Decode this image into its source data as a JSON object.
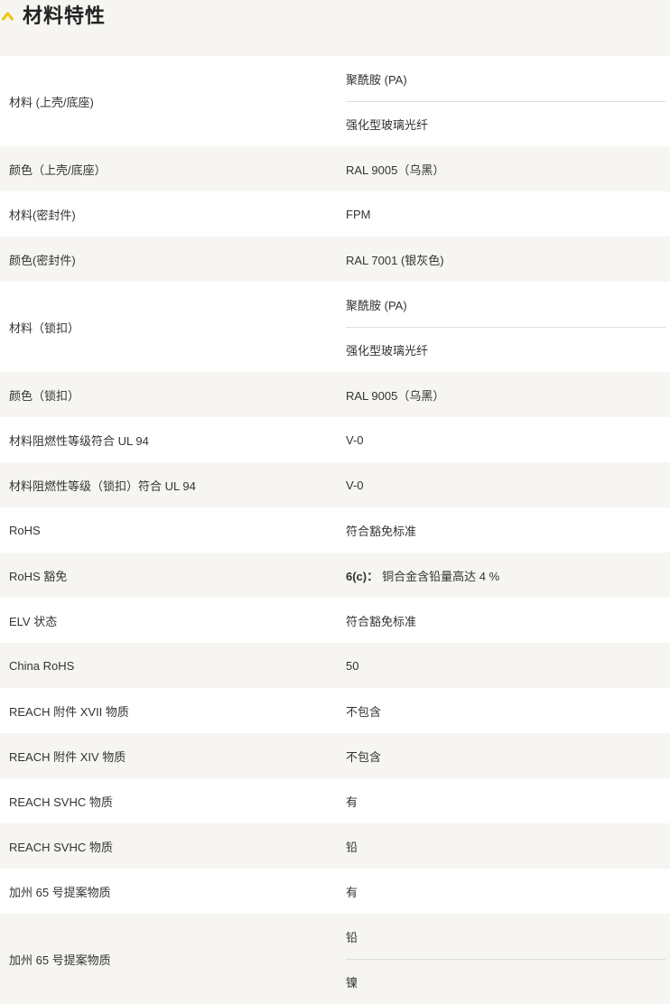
{
  "section": {
    "title": "材料特性",
    "accent_color": "#f2c500",
    "icon": "chevron-up-icon"
  },
  "rows": [
    {
      "label": "材料 (上壳/底座)",
      "values": [
        "聚酰胺 (PA)",
        "强化型玻璃光纤"
      ]
    },
    {
      "label": "颜色（上壳/底座）",
      "values": [
        "RAL 9005（乌黑）"
      ]
    },
    {
      "label": "材料(密封件)",
      "values": [
        "FPM"
      ]
    },
    {
      "label": "颜色(密封件)",
      "values": [
        "RAL 7001 (银灰色)"
      ]
    },
    {
      "label": "材料（锁扣）",
      "values": [
        "聚酰胺 (PA)",
        "强化型玻璃光纤"
      ]
    },
    {
      "label": "颜色（锁扣）",
      "values": [
        "RAL 9005（乌黑）"
      ]
    },
    {
      "label": "材料阻燃性等级符合 UL 94",
      "values": [
        "V-0"
      ]
    },
    {
      "label": "材料阻燃性等级（锁扣）符合 UL 94",
      "values": [
        "V-0"
      ]
    },
    {
      "label": "RoHS",
      "values": [
        "符合豁免标准"
      ]
    },
    {
      "label": "RoHS 豁免",
      "values": [
        "铜合金含铅量高达 4 %"
      ],
      "value_prefix": "6(c)："
    },
    {
      "label": "ELV 状态",
      "values": [
        "符合豁免标准"
      ]
    },
    {
      "label": "China RoHS",
      "values": [
        "50"
      ]
    },
    {
      "label": "REACH 附件 XVII 物质",
      "values": [
        "不包含"
      ]
    },
    {
      "label": "REACH 附件 XIV 物质",
      "values": [
        "不包含"
      ]
    },
    {
      "label": "REACH SVHC 物质",
      "values": [
        "有"
      ]
    },
    {
      "label": "REACH SVHC 物质",
      "values": [
        "铅"
      ]
    },
    {
      "label": "加州 65 号提案物质",
      "values": [
        "有"
      ]
    },
    {
      "label": "加州 65 号提案物质",
      "values": [
        "铅",
        "镍"
      ]
    }
  ]
}
